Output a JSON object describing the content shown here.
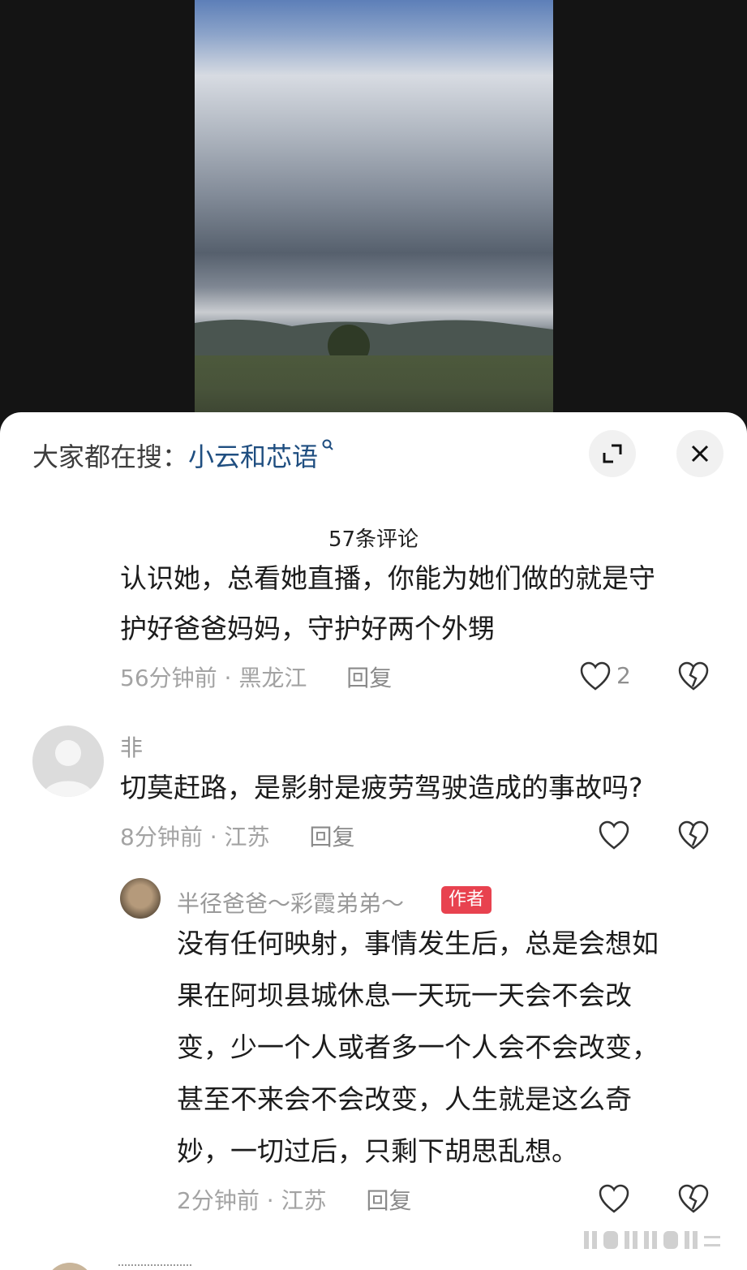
{
  "search": {
    "prefix": "大家都在搜：",
    "term": "小云和芯语"
  },
  "comments_header": {
    "count_label": "57条评论"
  },
  "comments": [
    {
      "text_line1": "认识她，总看她直播，你能为她们做的就是守",
      "text_line2": "护好爸爸妈妈，守护好两个外甥",
      "meta": "56分钟前 · 黑龙江",
      "reply_label": "回复",
      "likes": "2"
    },
    {
      "username": "非",
      "text": "切莫赶路，是影射是疲劳驾驶造成的事故吗?",
      "meta": "8分钟前 · 江苏",
      "reply_label": "回复",
      "reply": {
        "username": "半径爸爸～彩霞弟弟～",
        "badge": "作者",
        "lines": [
          "没有任何映射，事情发生后，总是会想如",
          "果在阿坝县城休息一天玩一天会不会改",
          "变，少一个人或者多一个人会不会改变，",
          "甚至不来会不会改变，人生就是这么奇",
          "妙，一切过后，只剩下胡思乱想。"
        ],
        "meta": "2分钟前 · 江苏",
        "reply_label": "回复"
      }
    }
  ],
  "colors": {
    "search_term": "#1f4e80",
    "badge": "#e8424f"
  },
  "icons": [
    "search-icon",
    "expand-icon",
    "close-icon",
    "heart-icon",
    "broken-heart-icon"
  ]
}
